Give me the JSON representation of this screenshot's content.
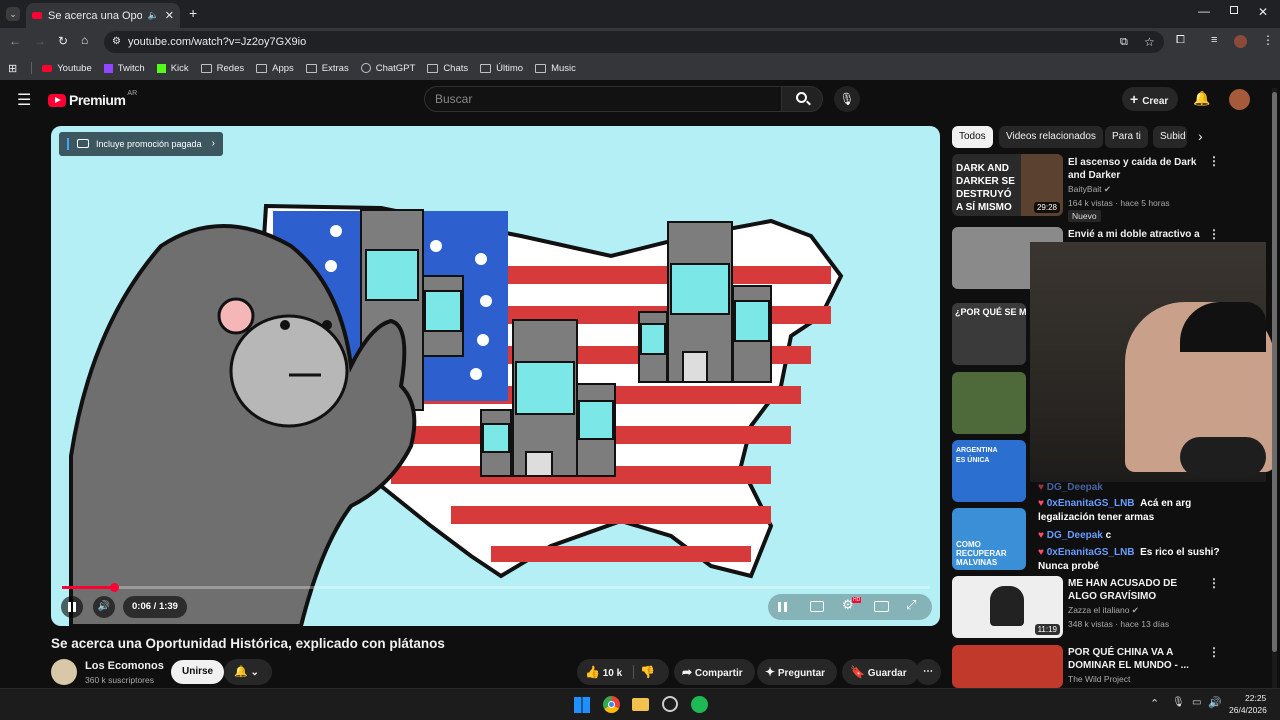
{
  "browser": {
    "tab_title": "Se acerca una Oportunidad",
    "url": "youtube.com/watch?v=Jz2oy7GX9io",
    "bookmarks": [
      "Youtube",
      "Twitch",
      "Kick",
      "Redes",
      "Apps",
      "Extras",
      "ChatGPT",
      "Chats",
      "Último",
      "Music"
    ]
  },
  "youtube": {
    "logo": "Premium",
    "region": "AR",
    "search_placeholder": "Buscar",
    "create_label": "Crear"
  },
  "player": {
    "promo_label": "Incluye promoción pagada",
    "time_current": "0:06",
    "time_total": "1:39",
    "progress": 0.06,
    "hd_badge": "HD"
  },
  "video": {
    "title": "Se acerca una Oportunidad Histórica, explicado con plátanos",
    "channel": "Los Ecomonos",
    "subscribers": "360 k suscriptores",
    "join_label": "Unirse",
    "likes": "10 k",
    "share_label": "Compartir",
    "ask_label": "Preguntar",
    "save_label": "Guardar"
  },
  "chips": [
    "Todos",
    "Videos relacionados",
    "Para ti",
    "Subid"
  ],
  "sidebar": [
    {
      "title": "El ascenso y caída de Dark and Darker",
      "channel": "BaityBait",
      "meta": "164 k vistas · hace 5 horas",
      "badge": "Nuevo",
      "duration": "29:28",
      "thumb_text": "DARK AND DARKER SE DESTRUYÓ A SÍ MISMO"
    },
    {
      "title": "Envié a mi doble atractivo a mi",
      "channel": "",
      "meta": "",
      "badge": "",
      "duration": "",
      "thumb_text": ""
    },
    {
      "title": "",
      "channel": "",
      "meta": "",
      "badge": "",
      "duration": "",
      "thumb_text": "¿POR QUÉ SE M"
    },
    {
      "title": "",
      "channel": "",
      "meta": "",
      "badge": "",
      "duration": "",
      "thumb_text": ""
    },
    {
      "title": "",
      "channel": "",
      "meta": "",
      "badge": "",
      "duration": "",
      "thumb_text": "ARGENTINA ES ÚNICA"
    },
    {
      "title": "",
      "channel": "",
      "meta": "",
      "badge": "",
      "duration": "",
      "thumb_text": "COMO RECUPERAR MALVINAS"
    },
    {
      "title": "ME HAN ACUSADO DE ALGO GRAVÍSIMO",
      "channel": "Zazza el italiano",
      "meta": "348 k vistas · hace 13 días",
      "badge": "",
      "duration": "11:19",
      "thumb_text": ""
    },
    {
      "title": "POR QUÉ CHINA VA A DOMINAR EL MUNDO - ...",
      "channel": "The Wild Project",
      "meta": "",
      "badge": "",
      "duration": "",
      "thumb_text": ""
    }
  ],
  "chat": [
    {
      "user": "DG_Deepak",
      "text": ""
    },
    {
      "user": "0xEnanitaGS_LNB",
      "text": "Acá en arg legalización tener armas"
    },
    {
      "user": "DG_Deepak",
      "text": "c"
    },
    {
      "user": "0xEnanitaGS_LNB",
      "text": "Es rico el sushi? Nunca probé"
    }
  ],
  "taskbar": {
    "time": "22:25",
    "date": "26/4/2026"
  },
  "colors": {
    "accent": "#ff0033",
    "chat_user": "#6b9bff",
    "bg": "#0f0f0f"
  }
}
